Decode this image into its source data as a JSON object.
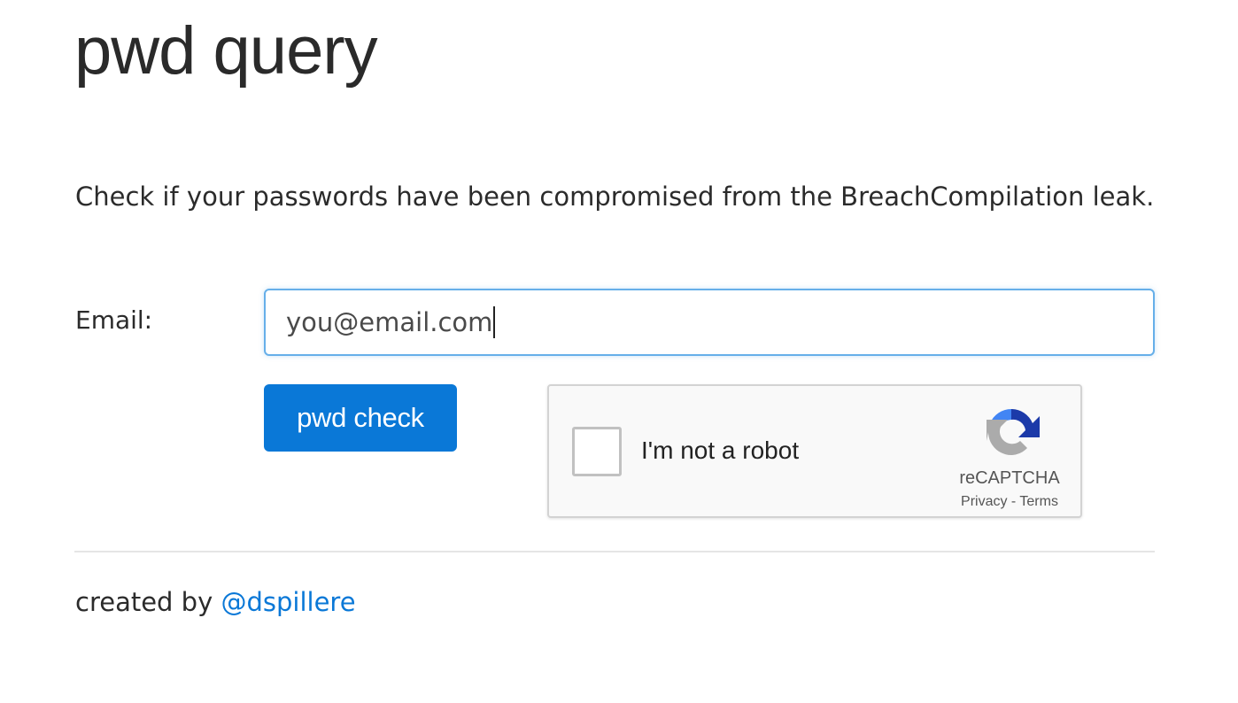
{
  "header": {
    "title": "pwd query"
  },
  "main": {
    "intro": "Check if your passwords have been compromised from the BreachCompilation leak.",
    "form": {
      "email_label": "Email:",
      "email_value": "you@email.com",
      "submit_label": "pwd check"
    },
    "recaptcha": {
      "label": "I'm not a robot",
      "brand": "reCAPTCHA",
      "privacy": "Privacy",
      "separator": " - ",
      "terms": "Terms",
      "colors": {
        "arrow_blue": "#1c3aa9",
        "arrow_light_blue": "#4285f4",
        "arrow_gray": "#ababab"
      }
    }
  },
  "footer": {
    "prefix": "created by ",
    "link_text": "@dspillere",
    "link_color": "#0a78d7"
  },
  "colors": {
    "accent": "#0a78d7",
    "input_focus_border": "#66afe9"
  }
}
